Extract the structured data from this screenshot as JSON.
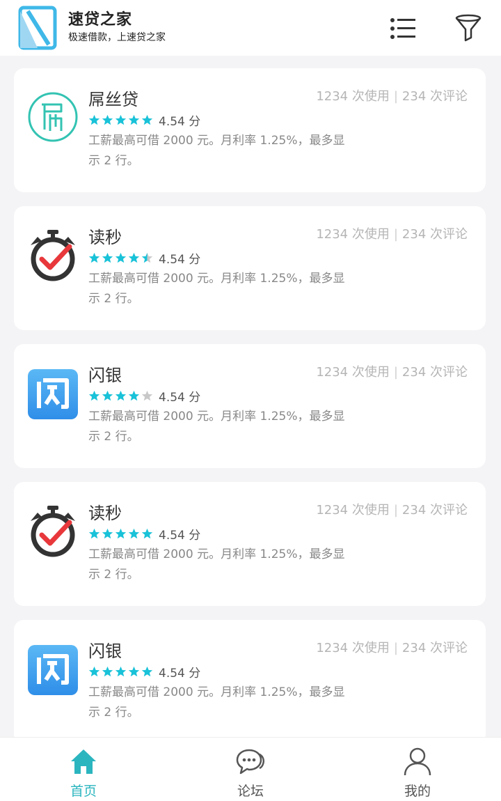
{
  "header": {
    "title": "速贷之家",
    "subtitle": "极速借款，上速贷之家",
    "accent": "#2bb5bf"
  },
  "products": [
    {
      "name": "屌丝贷",
      "logo": "diaosi-logo",
      "stars": 5,
      "rating": "4.54 分",
      "uses": "1234 次使用",
      "reviews": "234 次评论",
      "desc": "工薪最高可借 2000 元。月利率 1.25%，最多显示 2 行。"
    },
    {
      "name": "读秒",
      "logo": "dumiao-logo",
      "stars": 4.5,
      "rating": "4.54 分",
      "uses": "1234 次使用",
      "reviews": "234 次评论",
      "desc": "工薪最高可借 2000 元。月利率 1.25%，最多显示 2 行。"
    },
    {
      "name": "闪银",
      "logo": "shanyin-logo",
      "stars": 4,
      "rating": "4.54 分",
      "uses": "1234 次使用",
      "reviews": "234 次评论",
      "desc": "工薪最高可借 2000 元。月利率 1.25%，最多显示 2 行。"
    },
    {
      "name": "读秒",
      "logo": "dumiao-logo",
      "stars": 5,
      "rating": "4.54 分",
      "uses": "1234 次使用",
      "reviews": "234 次评论",
      "desc": "工薪最高可借 2000 元。月利率 1.25%，最多显示 2 行。"
    },
    {
      "name": "闪银",
      "logo": "shanyin-logo",
      "stars": 5,
      "rating": "4.54 分",
      "uses": "1234 次使用",
      "reviews": "234 次评论",
      "desc": "工薪最高可借 2000 元。月利率 1.25%，最多显示 2 行。"
    }
  ],
  "tabbar": {
    "home": "首页",
    "forum": "论坛",
    "me": "我的",
    "active": "home"
  },
  "colors": {
    "star_on": "#19c2d8",
    "star_off": "#c8c8c8",
    "active_tab": "#2bb5bf"
  }
}
